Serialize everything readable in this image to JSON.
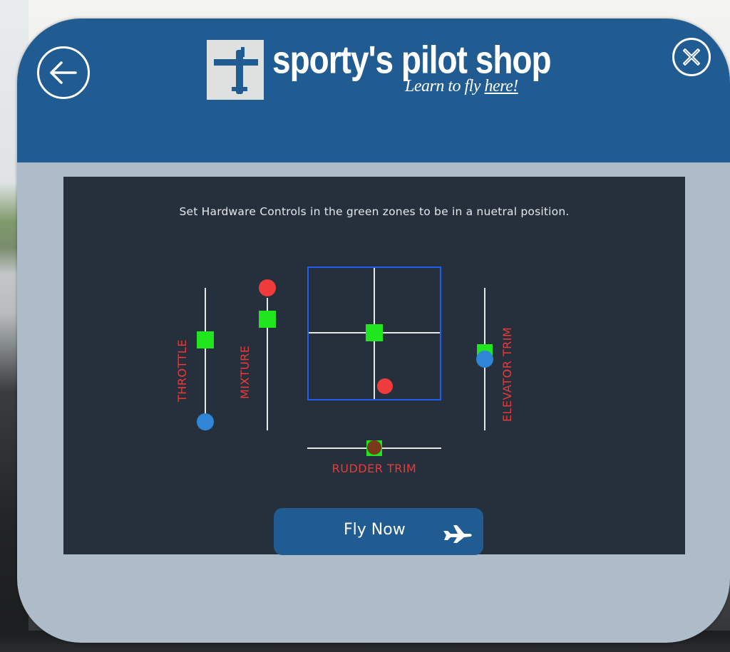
{
  "header": {
    "logo": {
      "wordmark": "sporty's pilot shop",
      "registered_mark": "®",
      "tagline_prefix": "Learn to fly ",
      "tagline_emphasis": "here!"
    },
    "back_icon": "arrow-left-icon",
    "close_icon": "close-x-icon"
  },
  "panel": {
    "instructions": "Set Hardware Controls in the green zones to be in a nuetral position."
  },
  "controls": {
    "throttle": {
      "label": "THROTTLE",
      "position": 0.0,
      "knob_color": "#2f86d6"
    },
    "mixture": {
      "label": "MIXTURE",
      "position": 1.0,
      "knob_color": "#ef3b3b"
    },
    "yoke": {
      "knob_color": "#ef3b3b"
    },
    "rudder_trim": {
      "label": "RUDDER TRIM",
      "knob_color": "#7a3a1a"
    },
    "elevator_trim": {
      "label": "ELEVATOR TRIM",
      "knob_color": "#2f86d6"
    }
  },
  "fly_button": {
    "label": "Fly Now",
    "icon": "airplane-icon"
  },
  "colors": {
    "header": "#205b92",
    "dialog": "#aebbc9",
    "panel": "#25303c",
    "green_zone": "#1fe61f",
    "label_red": "#e83a3a",
    "yoke_box": "#1f5ff0"
  }
}
